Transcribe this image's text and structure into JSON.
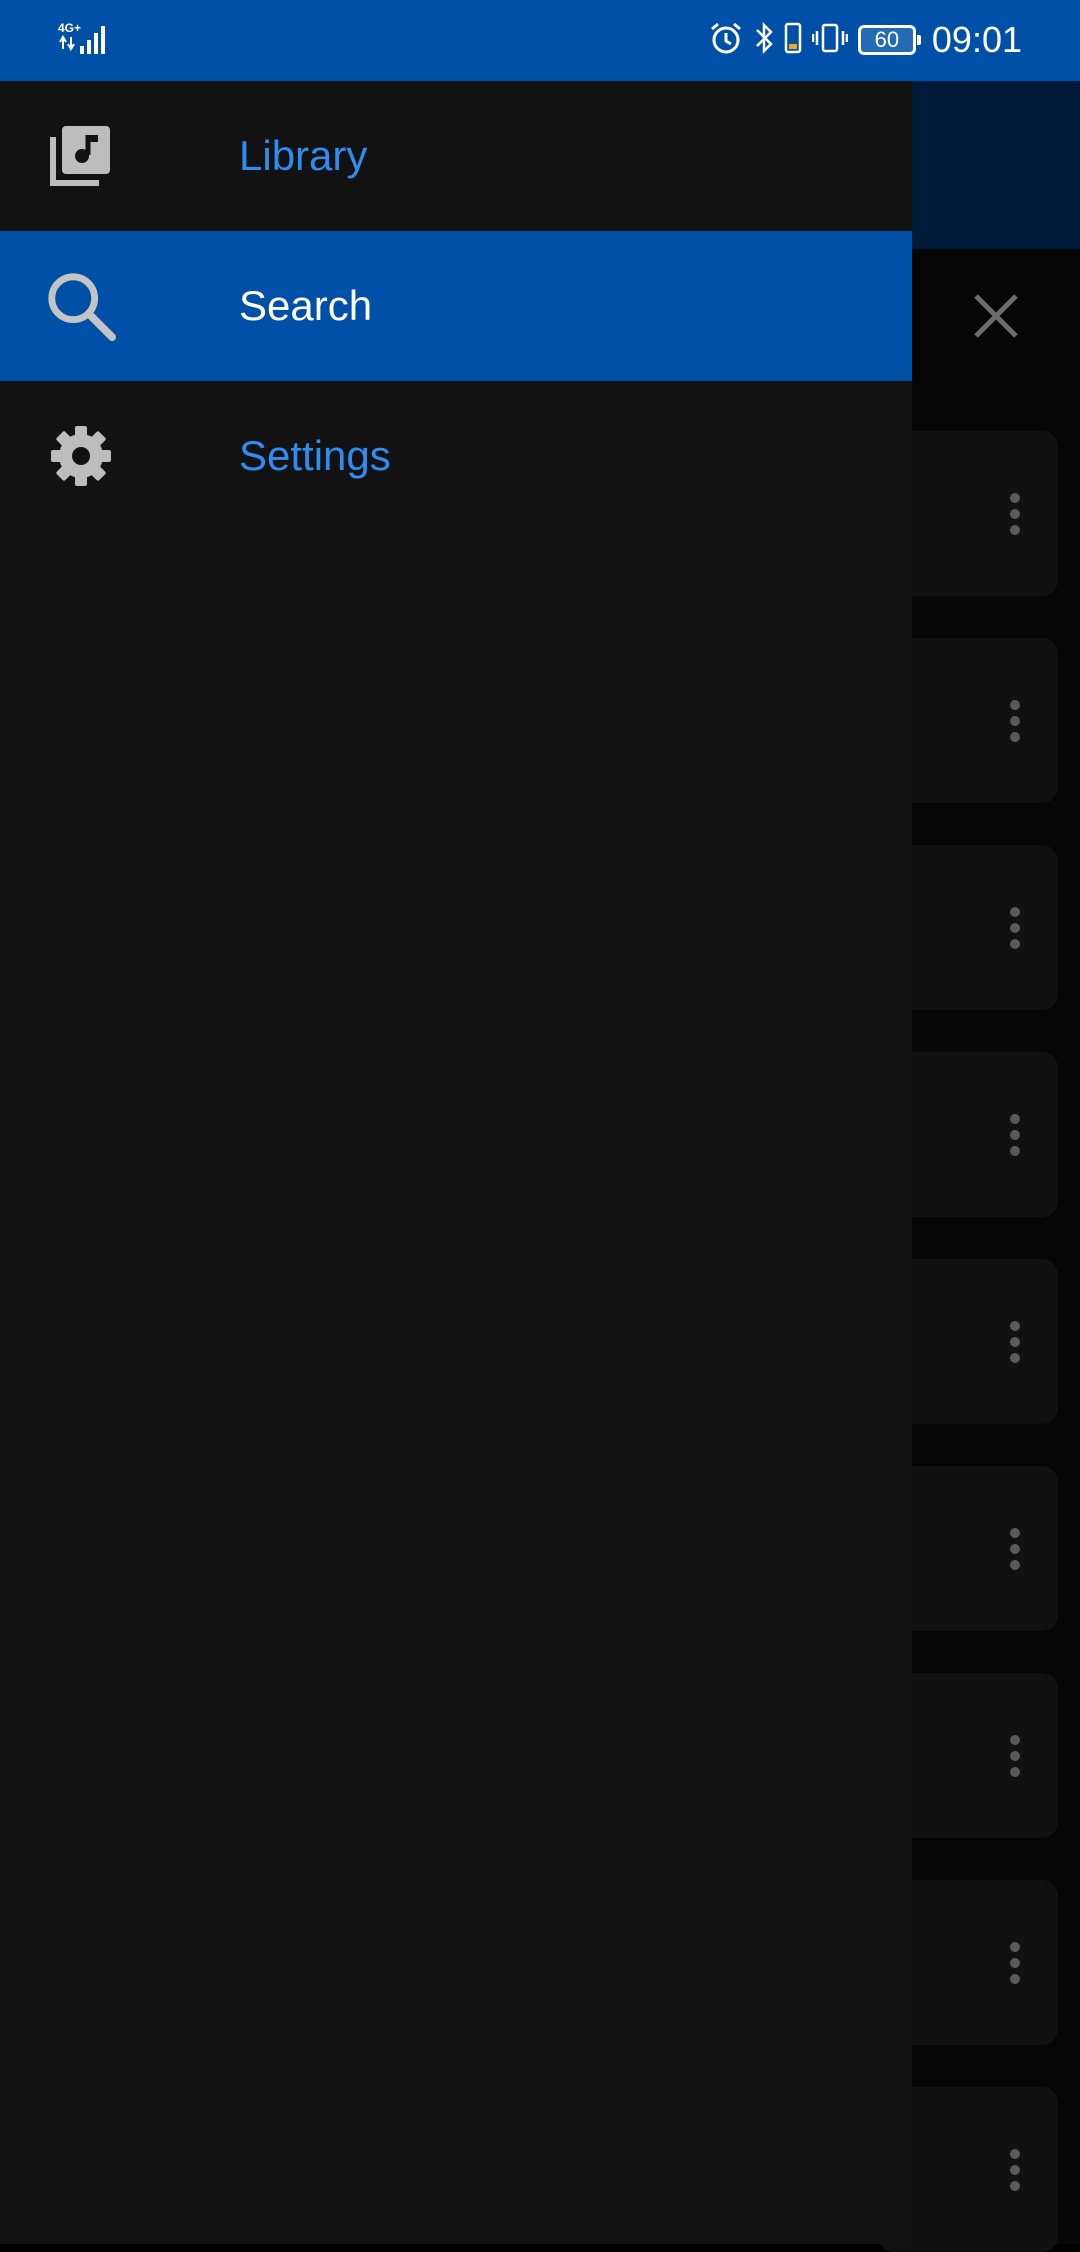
{
  "status_bar": {
    "network": "4G+",
    "time": "09:01",
    "battery": "60",
    "icons": [
      "signal-icon",
      "alarm-icon",
      "bluetooth-icon",
      "vibrate-icon",
      "battery-icon"
    ]
  },
  "drawer": {
    "items": [
      {
        "label": "Library",
        "icon": "music-library-icon",
        "active": false
      },
      {
        "label": "Search",
        "icon": "search-icon",
        "active": true
      },
      {
        "label": "Settings",
        "icon": "gear-icon",
        "active": false
      }
    ]
  },
  "colors": {
    "brand": "#0050a7",
    "accent_text": "#2f8cf0",
    "drawer_bg": "#121212"
  }
}
